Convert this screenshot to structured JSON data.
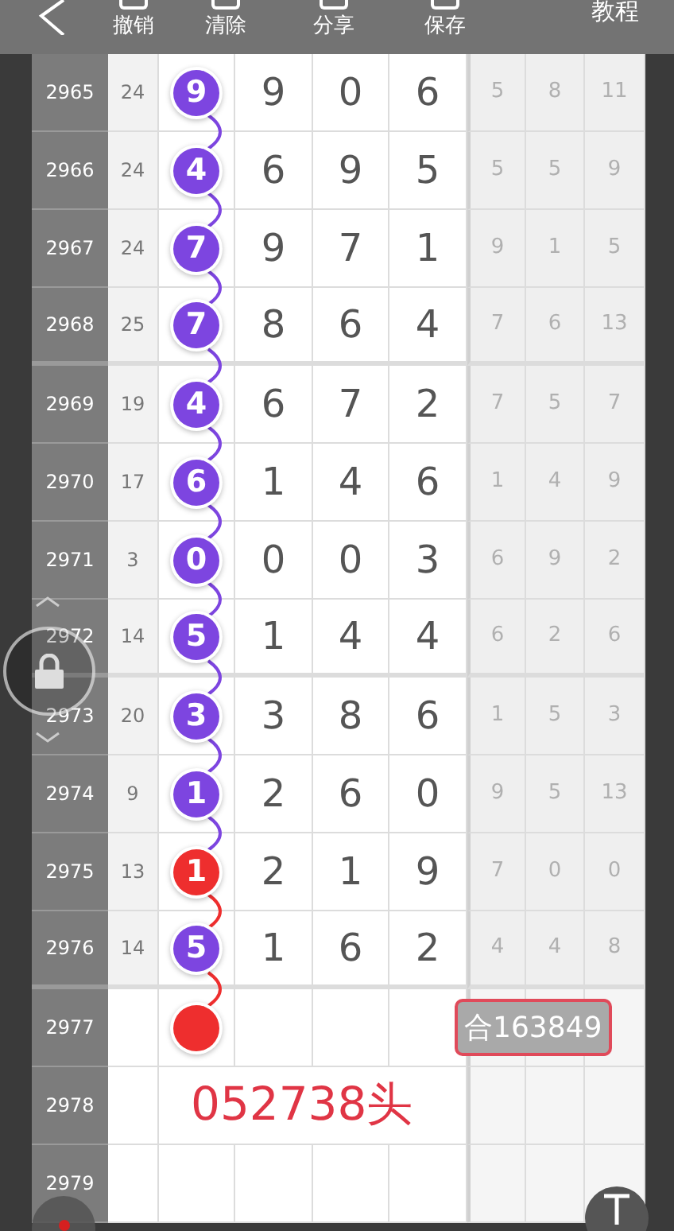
{
  "toolbar": {
    "items": [
      "撤销",
      "清除",
      "分享",
      "保存"
    ],
    "tutorial": "教程"
  },
  "rows": [
    {
      "period": "2965",
      "count": "24",
      "ball": {
        "digit": "9",
        "color": "#7d45e0"
      },
      "digits": [
        "9",
        "0",
        "6"
      ],
      "stats": [
        "5",
        "8",
        "11"
      ]
    },
    {
      "period": "2966",
      "count": "24",
      "ball": {
        "digit": "4",
        "color": "#7d45e0"
      },
      "digits": [
        "6",
        "9",
        "5"
      ],
      "stats": [
        "5",
        "5",
        "9"
      ]
    },
    {
      "period": "2967",
      "count": "24",
      "ball": {
        "digit": "7",
        "color": "#7d45e0"
      },
      "digits": [
        "9",
        "7",
        "1"
      ],
      "stats": [
        "9",
        "1",
        "5"
      ]
    },
    {
      "period": "2968",
      "count": "25",
      "ball": {
        "digit": "7",
        "color": "#7d45e0"
      },
      "digits": [
        "8",
        "6",
        "4"
      ],
      "stats": [
        "7",
        "6",
        "13"
      ]
    },
    {
      "period": "2969",
      "count": "19",
      "ball": {
        "digit": "4",
        "color": "#7d45e0"
      },
      "digits": [
        "6",
        "7",
        "2"
      ],
      "stats": [
        "7",
        "5",
        "7"
      ]
    },
    {
      "period": "2970",
      "count": "17",
      "ball": {
        "digit": "6",
        "color": "#7d45e0"
      },
      "digits": [
        "1",
        "4",
        "6"
      ],
      "stats": [
        "1",
        "4",
        "9"
      ]
    },
    {
      "period": "2971",
      "count": "3",
      "ball": {
        "digit": "0",
        "color": "#7d45e0"
      },
      "digits": [
        "0",
        "0",
        "3"
      ],
      "stats": [
        "6",
        "9",
        "2"
      ]
    },
    {
      "period": "2972",
      "count": "14",
      "ball": {
        "digit": "5",
        "color": "#7d45e0"
      },
      "digits": [
        "1",
        "4",
        "4"
      ],
      "stats": [
        "6",
        "2",
        "6"
      ]
    },
    {
      "period": "2973",
      "count": "20",
      "ball": {
        "digit": "3",
        "color": "#7d45e0"
      },
      "digits": [
        "3",
        "8",
        "6"
      ],
      "stats": [
        "1",
        "5",
        "3"
      ]
    },
    {
      "period": "2974",
      "count": "9",
      "ball": {
        "digit": "1",
        "color": "#7d45e0"
      },
      "digits": [
        "2",
        "6",
        "0"
      ],
      "stats": [
        "9",
        "5",
        "13"
      ]
    },
    {
      "period": "2975",
      "count": "13",
      "ball": {
        "digit": "1",
        "color": "#ee2e2e"
      },
      "digits": [
        "2",
        "1",
        "9"
      ],
      "stats": [
        "7",
        "0",
        "0"
      ]
    },
    {
      "period": "2976",
      "count": "14",
      "ball": {
        "digit": "5",
        "color": "#7d45e0"
      },
      "digits": [
        "1",
        "6",
        "2"
      ],
      "stats": [
        "4",
        "4",
        "8"
      ]
    }
  ],
  "pending_rows": [
    {
      "period": "2977",
      "kind": "dot",
      "color": "#ee2e2e",
      "sum_label": "合163849"
    },
    {
      "period": "2978",
      "kind": "note",
      "note": "052738头"
    },
    {
      "period": "2979",
      "kind": "blank"
    }
  ]
}
